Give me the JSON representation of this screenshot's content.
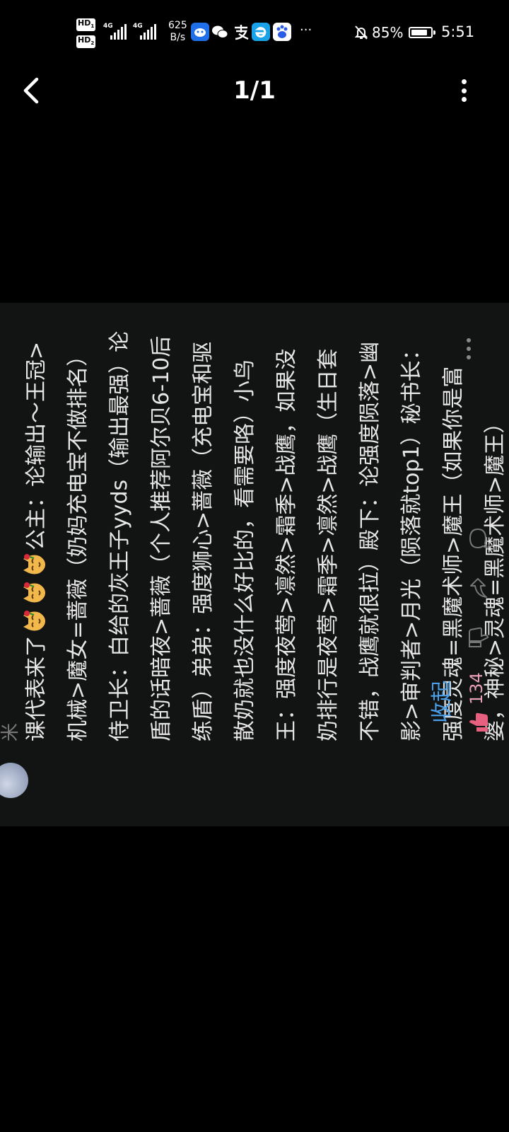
{
  "statusbar": {
    "sim1": "HD",
    "sim2": "HD",
    "net1": "4G",
    "net2": "4G",
    "speed_value": "625",
    "speed_unit": "B/s",
    "more_dots": "···",
    "battery_pct": "85%",
    "battery_level": 0.85,
    "time": "5:51"
  },
  "nav": {
    "pager": "1/1"
  },
  "comment": {
    "text_before_emoji": "课代表来了",
    "emoji_count": 3,
    "text_after_emoji": "公主：论输出～王冠>机械>魔女=蔷薇（奶妈充电宝不做排名）侍卫长：白给的灰王子yyds（输出最强）论盾的话暗夜>蔷薇（个人推荐阿尔贝6-10后练盾）弟弟：强度狮心>蔷薇（充电宝和驱散奶就也没什么好比的，看需要咯）小鸟王：强度夜莺>凛然>霜季>战鹰，如果没奶排行是夜莺>霜季>凛然>战鹰（生日套不错，战鹰就很拉）殿下：论强度陨落>幽影>审判者>月光（陨落就top1）秘书长：强度灵魂=黑魔术师>魔王（如果你是富婆，神秘>灵魂=黑魔术师>魔王）",
    "collapse_label": "收起",
    "like_count": "134"
  },
  "colors": {
    "link": "#4a9fe8",
    "like": "#e8607f",
    "card_bg": "#121413"
  },
  "icons": [
    "back-arrow-icon",
    "more-vertical-icon",
    "like-icon",
    "dislike-icon",
    "share-icon",
    "reply-icon",
    "more-horizontal-icon",
    "cat-rose-emoji"
  ]
}
